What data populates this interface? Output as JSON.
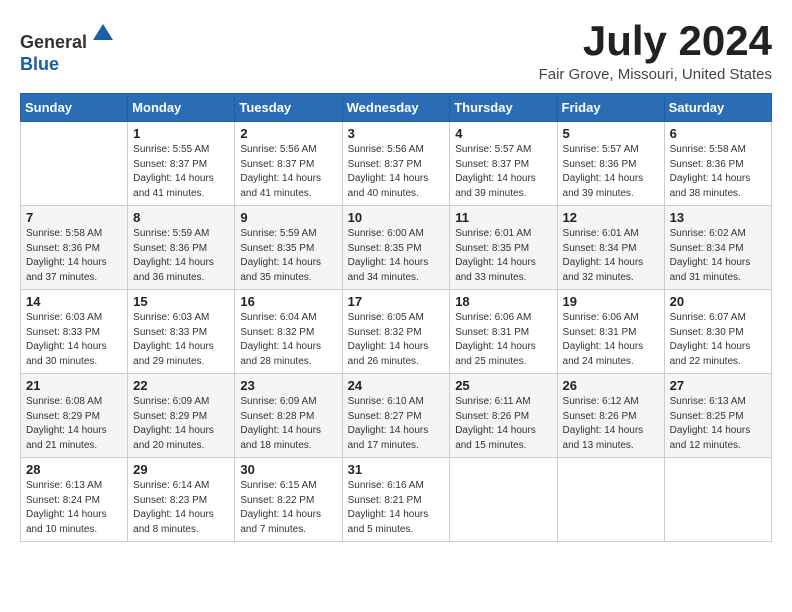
{
  "header": {
    "logo": {
      "line1": "General",
      "line2": "Blue"
    },
    "title": "July 2024",
    "location": "Fair Grove, Missouri, United States"
  },
  "weekdays": [
    "Sunday",
    "Monday",
    "Tuesday",
    "Wednesday",
    "Thursday",
    "Friday",
    "Saturday"
  ],
  "weeks": [
    [
      {
        "day": "",
        "sunrise": "",
        "sunset": "",
        "daylight": ""
      },
      {
        "day": "1",
        "sunrise": "5:55 AM",
        "sunset": "8:37 PM",
        "daylight": "14 hours and 41 minutes."
      },
      {
        "day": "2",
        "sunrise": "5:56 AM",
        "sunset": "8:37 PM",
        "daylight": "14 hours and 41 minutes."
      },
      {
        "day": "3",
        "sunrise": "5:56 AM",
        "sunset": "8:37 PM",
        "daylight": "14 hours and 40 minutes."
      },
      {
        "day": "4",
        "sunrise": "5:57 AM",
        "sunset": "8:37 PM",
        "daylight": "14 hours and 39 minutes."
      },
      {
        "day": "5",
        "sunrise": "5:57 AM",
        "sunset": "8:36 PM",
        "daylight": "14 hours and 39 minutes."
      },
      {
        "day": "6",
        "sunrise": "5:58 AM",
        "sunset": "8:36 PM",
        "daylight": "14 hours and 38 minutes."
      }
    ],
    [
      {
        "day": "7",
        "sunrise": "5:58 AM",
        "sunset": "8:36 PM",
        "daylight": "14 hours and 37 minutes."
      },
      {
        "day": "8",
        "sunrise": "5:59 AM",
        "sunset": "8:36 PM",
        "daylight": "14 hours and 36 minutes."
      },
      {
        "day": "9",
        "sunrise": "5:59 AM",
        "sunset": "8:35 PM",
        "daylight": "14 hours and 35 minutes."
      },
      {
        "day": "10",
        "sunrise": "6:00 AM",
        "sunset": "8:35 PM",
        "daylight": "14 hours and 34 minutes."
      },
      {
        "day": "11",
        "sunrise": "6:01 AM",
        "sunset": "8:35 PM",
        "daylight": "14 hours and 33 minutes."
      },
      {
        "day": "12",
        "sunrise": "6:01 AM",
        "sunset": "8:34 PM",
        "daylight": "14 hours and 32 minutes."
      },
      {
        "day": "13",
        "sunrise": "6:02 AM",
        "sunset": "8:34 PM",
        "daylight": "14 hours and 31 minutes."
      }
    ],
    [
      {
        "day": "14",
        "sunrise": "6:03 AM",
        "sunset": "8:33 PM",
        "daylight": "14 hours and 30 minutes."
      },
      {
        "day": "15",
        "sunrise": "6:03 AM",
        "sunset": "8:33 PM",
        "daylight": "14 hours and 29 minutes."
      },
      {
        "day": "16",
        "sunrise": "6:04 AM",
        "sunset": "8:32 PM",
        "daylight": "14 hours and 28 minutes."
      },
      {
        "day": "17",
        "sunrise": "6:05 AM",
        "sunset": "8:32 PM",
        "daylight": "14 hours and 26 minutes."
      },
      {
        "day": "18",
        "sunrise": "6:06 AM",
        "sunset": "8:31 PM",
        "daylight": "14 hours and 25 minutes."
      },
      {
        "day": "19",
        "sunrise": "6:06 AM",
        "sunset": "8:31 PM",
        "daylight": "14 hours and 24 minutes."
      },
      {
        "day": "20",
        "sunrise": "6:07 AM",
        "sunset": "8:30 PM",
        "daylight": "14 hours and 22 minutes."
      }
    ],
    [
      {
        "day": "21",
        "sunrise": "6:08 AM",
        "sunset": "8:29 PM",
        "daylight": "14 hours and 21 minutes."
      },
      {
        "day": "22",
        "sunrise": "6:09 AM",
        "sunset": "8:29 PM",
        "daylight": "14 hours and 20 minutes."
      },
      {
        "day": "23",
        "sunrise": "6:09 AM",
        "sunset": "8:28 PM",
        "daylight": "14 hours and 18 minutes."
      },
      {
        "day": "24",
        "sunrise": "6:10 AM",
        "sunset": "8:27 PM",
        "daylight": "14 hours and 17 minutes."
      },
      {
        "day": "25",
        "sunrise": "6:11 AM",
        "sunset": "8:26 PM",
        "daylight": "14 hours and 15 minutes."
      },
      {
        "day": "26",
        "sunrise": "6:12 AM",
        "sunset": "8:26 PM",
        "daylight": "14 hours and 13 minutes."
      },
      {
        "day": "27",
        "sunrise": "6:13 AM",
        "sunset": "8:25 PM",
        "daylight": "14 hours and 12 minutes."
      }
    ],
    [
      {
        "day": "28",
        "sunrise": "6:13 AM",
        "sunset": "8:24 PM",
        "daylight": "14 hours and 10 minutes."
      },
      {
        "day": "29",
        "sunrise": "6:14 AM",
        "sunset": "8:23 PM",
        "daylight": "14 hours and 8 minutes."
      },
      {
        "day": "30",
        "sunrise": "6:15 AM",
        "sunset": "8:22 PM",
        "daylight": "14 hours and 7 minutes."
      },
      {
        "day": "31",
        "sunrise": "6:16 AM",
        "sunset": "8:21 PM",
        "daylight": "14 hours and 5 minutes."
      },
      {
        "day": "",
        "sunrise": "",
        "sunset": "",
        "daylight": ""
      },
      {
        "day": "",
        "sunrise": "",
        "sunset": "",
        "daylight": ""
      },
      {
        "day": "",
        "sunrise": "",
        "sunset": "",
        "daylight": ""
      }
    ]
  ]
}
